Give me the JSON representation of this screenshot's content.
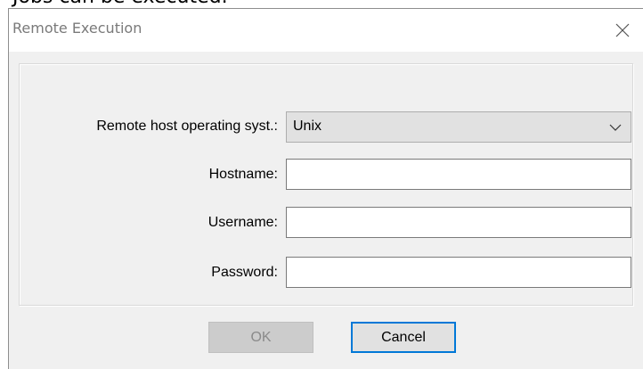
{
  "background": {
    "partial_text": "Jobs can be executed."
  },
  "dialog": {
    "title": "Remote Execution",
    "close_icon": "close-icon"
  },
  "form": {
    "os_label": "Remote host operating syst.:",
    "os_value": "Unix",
    "hostname_label": "Hostname:",
    "hostname_value": "",
    "username_label": "Username:",
    "username_value": "",
    "password_label": "Password:",
    "password_value": ""
  },
  "buttons": {
    "ok_label": "OK",
    "ok_enabled": false,
    "cancel_label": "Cancel"
  },
  "colors": {
    "focus_border": "#0078d7",
    "dialog_bg": "#f0f0f0",
    "disabled_text": "#8a8a8a"
  }
}
